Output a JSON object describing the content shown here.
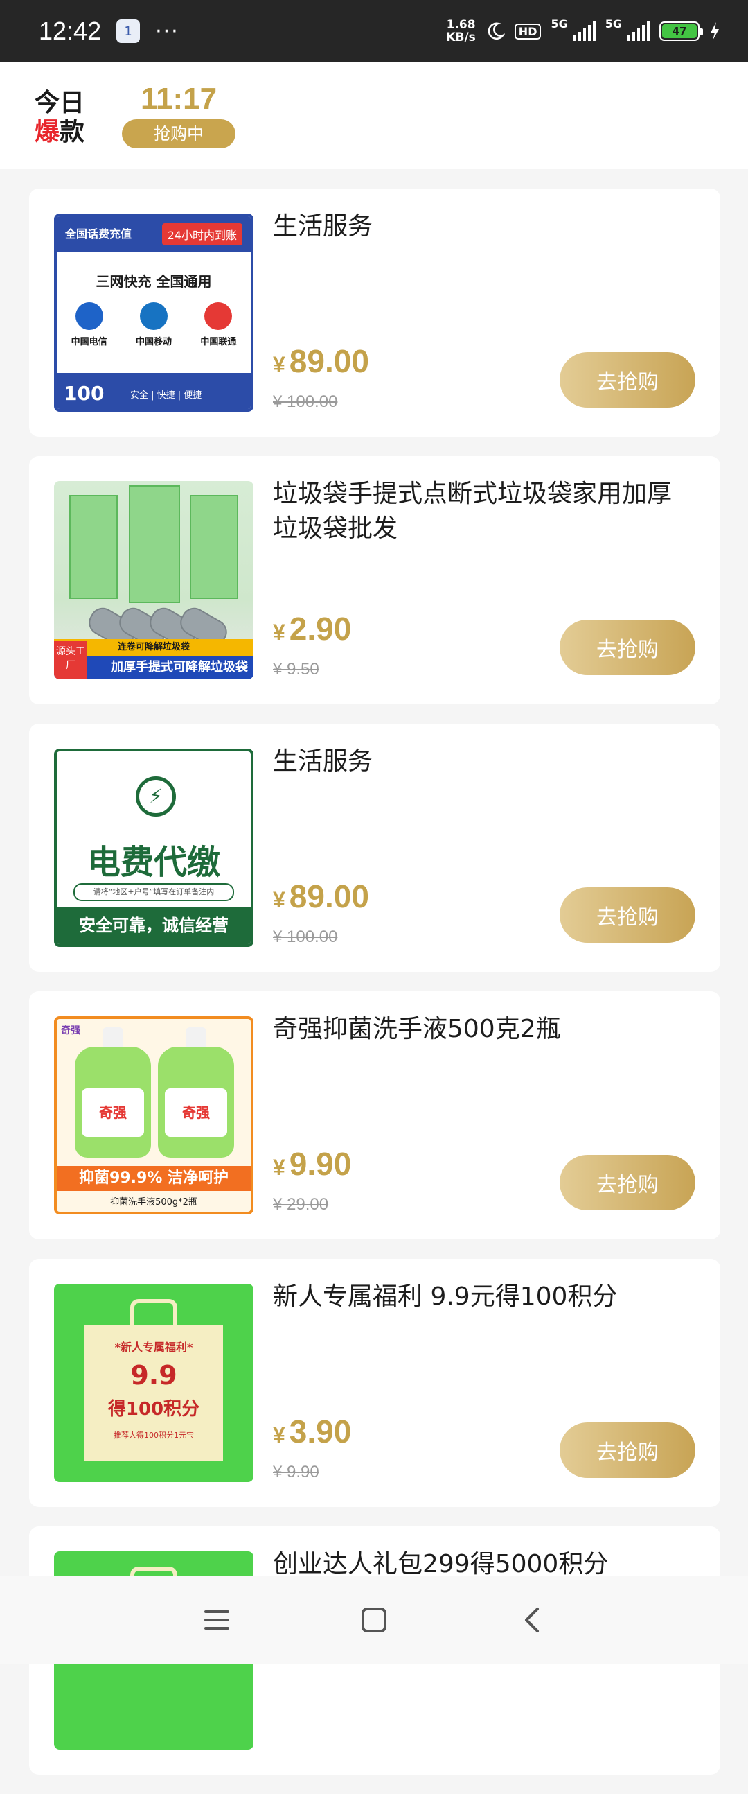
{
  "status_bar": {
    "time": "12:42",
    "app_badge": "1",
    "more": "···",
    "speed_value": "1.68",
    "speed_unit": "KB/s",
    "hd": "HD",
    "net1": "5G",
    "net2": "5G",
    "battery": "47"
  },
  "header": {
    "logo_line1": "今日",
    "logo_hot": "爆",
    "logo_line2_rest": "款",
    "flash_time": "11:17",
    "flash_status": "抢购中"
  },
  "products": [
    {
      "title": "生活服务",
      "currency": "¥",
      "price": "89.00",
      "original_price": "¥ 100.00",
      "button": "去抢购",
      "thumb": {
        "top_left": "全国话费充值",
        "top_right": "24小时内到账",
        "mid": "三网快充    全国通用",
        "logo1": "中国电信",
        "logo2": "中国移动",
        "logo3": "中国联通",
        "value": "100",
        "slogan": "安全 | 快捷 | 便捷"
      }
    },
    {
      "title": "垃圾袋手提式点断式垃圾袋家用加厚垃圾袋批发",
      "currency": "¥",
      "price": "2.90",
      "original_price": "¥ 9.50",
      "button": "去抢购",
      "thumb": {
        "tag": "源头工厂",
        "band1": "连卷可降解垃圾袋",
        "band2": "加厚手提式可降解垃圾袋"
      }
    },
    {
      "title": "生活服务",
      "currency": "¥",
      "price": "89.00",
      "original_price": "¥ 100.00",
      "button": "去抢购",
      "thumb": {
        "big": "电费代缴",
        "small": "请将“地区+户号”填写在订单备注内",
        "bottom": "安全可靠，诚信经营"
      }
    },
    {
      "title": "奇强抑菌洗手液500克2瓶",
      "currency": "¥",
      "price": "9.90",
      "original_price": "¥ 29.00",
      "button": "去抢购",
      "thumb": {
        "brand": "奇强",
        "label": "奇强",
        "band": "抑菌99.9% 洁净呵护",
        "sub": "抑菌洗手液500g*2瓶"
      }
    },
    {
      "title": "新人专属福利 9.9元得100积分",
      "currency": "¥",
      "price": "3.90",
      "original_price": "¥ 9.90",
      "button": "去抢购",
      "thumb": {
        "l1": "*新人专属福利*",
        "l2": "9.9",
        "l3": "得100积分",
        "l4": "推荐人得100积分1元宝"
      }
    },
    {
      "title": "创业达人礼包299得5000积分"
    }
  ],
  "colors": {
    "gold": "#c4a24a",
    "hot_red": "#e8262c",
    "status_bar": "#262626"
  }
}
